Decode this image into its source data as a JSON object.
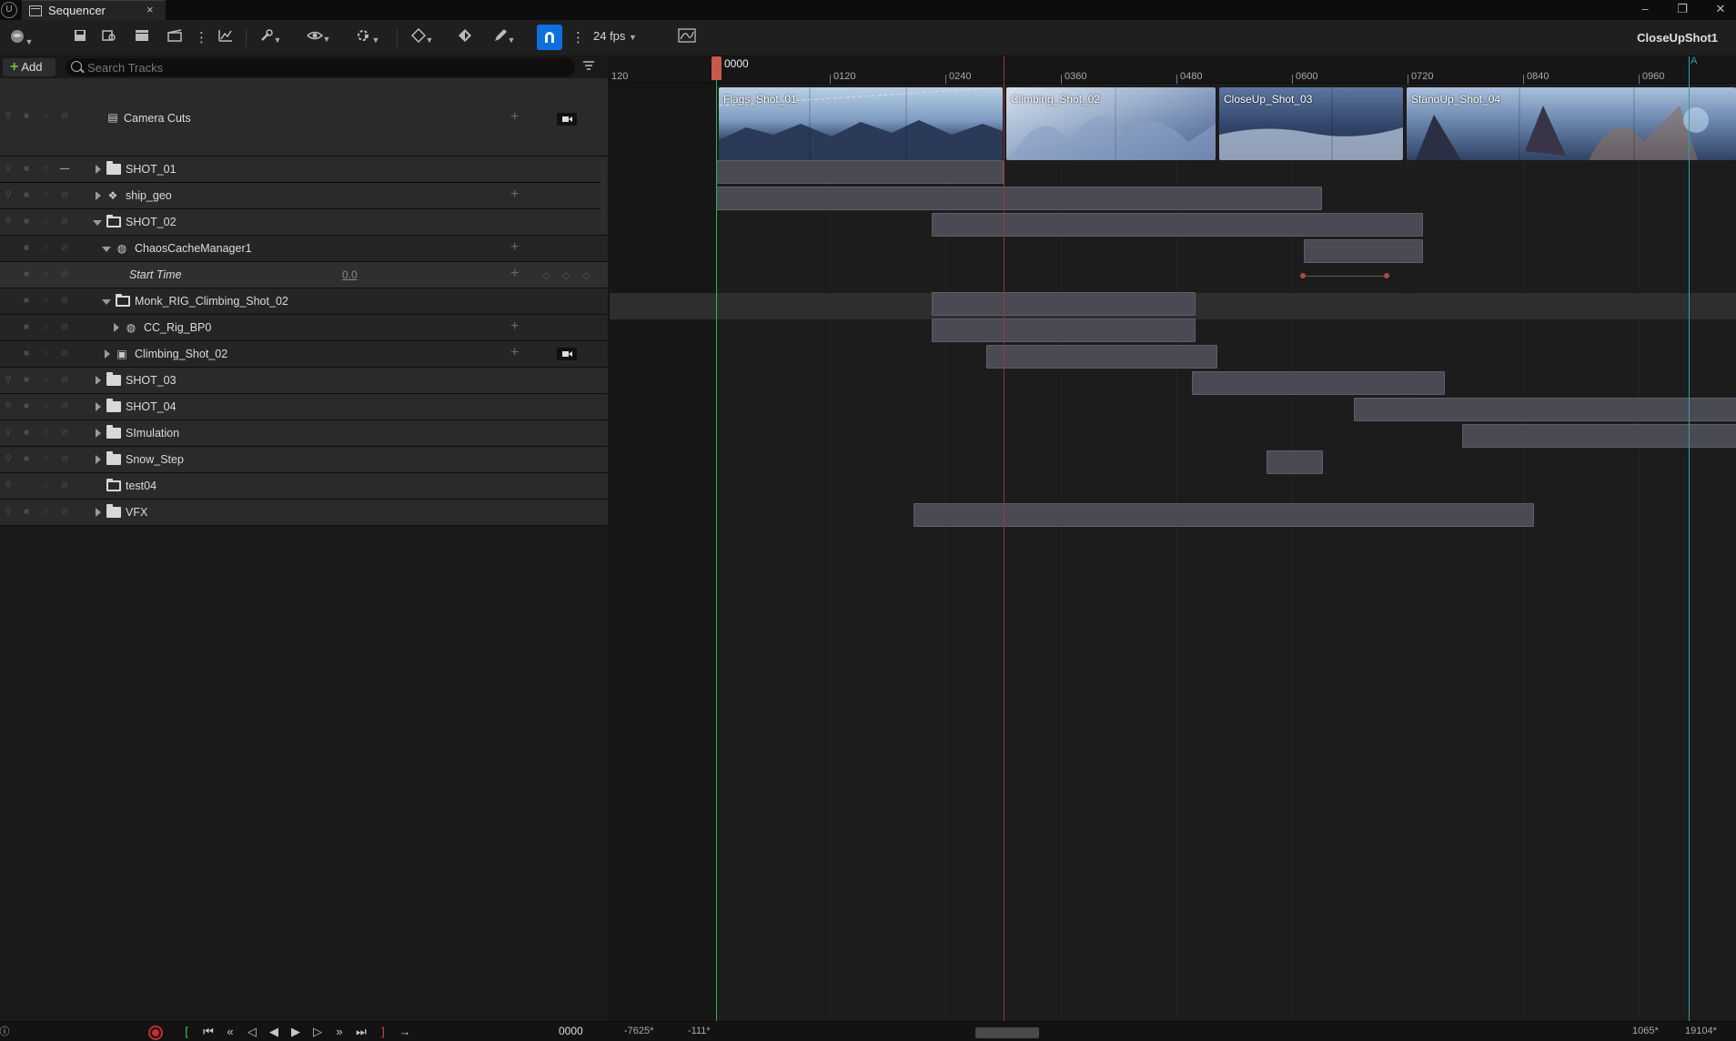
{
  "window": {
    "tab_title": "Sequencer",
    "tab_close": "×",
    "logo": "U",
    "minimize": "–",
    "maximize": "❐",
    "close": "✕"
  },
  "toolbar": {
    "fps": "24 fps",
    "sequence_name": "CloseUpShot1",
    "snap_icon": "magnet-icon"
  },
  "filter": {
    "add_label": "Add",
    "add_plus": "+",
    "search_placeholder": "Search Tracks"
  },
  "tracks": [
    {
      "label": "Camera Cuts",
      "type": "camera-cuts"
    },
    {
      "label": "SHOT_01",
      "type": "folder"
    },
    {
      "label": "ship_geo",
      "type": "geo"
    },
    {
      "label": "SHOT_02",
      "type": "folder-open"
    },
    {
      "label": "ChaosCacheManager1",
      "type": "actor"
    },
    {
      "label": "Start Time",
      "type": "property",
      "value": "0.0"
    },
    {
      "label": "Monk_RIG_Climbing_Shot_02",
      "type": "folder-open"
    },
    {
      "label": "CC_Rig_BP0",
      "type": "actor"
    },
    {
      "label": "Climbing_Shot_02",
      "type": "camera"
    },
    {
      "label": "SHOT_03",
      "type": "folder"
    },
    {
      "label": "SHOT_04",
      "type": "folder"
    },
    {
      "label": "SImulation",
      "type": "folder"
    },
    {
      "label": "Snow_Step",
      "type": "folder"
    },
    {
      "label": "test04",
      "type": "folder"
    },
    {
      "label": "VFX",
      "type": "folder"
    }
  ],
  "ruler": {
    "playhead": "0000",
    "ticks": [
      "120",
      "0120",
      "0240",
      "0360",
      "0480",
      "0600",
      "0720",
      "0840",
      "0960"
    ],
    "end_marker": "A"
  },
  "camera_cuts": [
    {
      "label": "Flags_Shot_01"
    },
    {
      "label": "Climbing_Shot_02"
    },
    {
      "label": "CloseUp_Shot_03"
    },
    {
      "label": "StandUp_Shot_04"
    }
  ],
  "bottom": {
    "view_start": "-7625*",
    "view_start2": "-111*",
    "current": "0000",
    "view_end": "1065*",
    "view_end2": "19104*"
  }
}
